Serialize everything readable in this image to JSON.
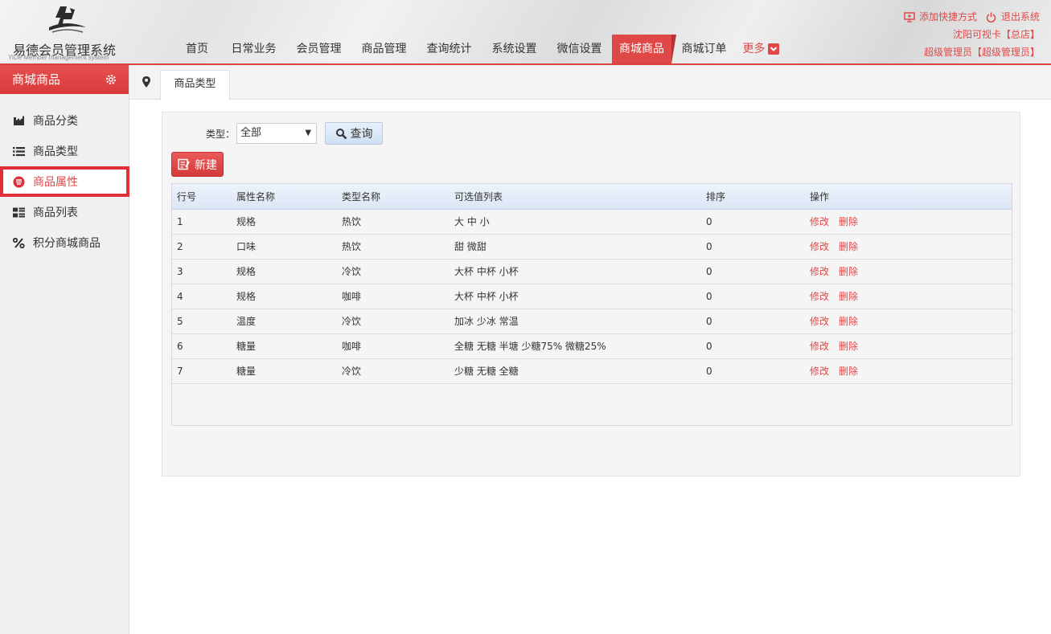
{
  "app": {
    "title": "易德会员管理系统",
    "subtitle": "YiDe Member management system"
  },
  "nav": {
    "items": [
      {
        "label": "首页",
        "name": "nav-home",
        "active": false
      },
      {
        "label": "日常业务",
        "name": "nav-daily",
        "active": false
      },
      {
        "label": "会员管理",
        "name": "nav-member",
        "active": false
      },
      {
        "label": "商品管理",
        "name": "nav-goods",
        "active": false
      },
      {
        "label": "查询统计",
        "name": "nav-query",
        "active": false
      },
      {
        "label": "系统设置",
        "name": "nav-settings",
        "active": false
      },
      {
        "label": "微信设置",
        "name": "nav-wechat",
        "active": false
      },
      {
        "label": "商城商品",
        "name": "nav-mall-goods",
        "active": true
      },
      {
        "label": "商城订单",
        "name": "nav-mall-orders",
        "active": false
      }
    ],
    "more_label": "更多"
  },
  "top_right": {
    "add_shortcut": "添加快捷方式",
    "logout": "退出系统",
    "store": "沈阳可视卡【总店】",
    "user": "超级管理员【超级管理员】"
  },
  "sidebar": {
    "title": "商城商品",
    "items": [
      {
        "label": "商品分类",
        "icon": "factory-icon"
      },
      {
        "label": "商品类型",
        "icon": "list-icon"
      },
      {
        "label": "商品属性",
        "icon": "tag-circle-icon"
      },
      {
        "label": "商品列表",
        "icon": "grid-list-icon"
      },
      {
        "label": "积分商城商品",
        "icon": "percent-icon"
      }
    ],
    "active_index": 2
  },
  "tabs": {
    "current": "商品类型"
  },
  "filter": {
    "type_label": "类型：",
    "type_value": "全部",
    "query_label": "查询"
  },
  "toolbar": {
    "new_label": "新建"
  },
  "table": {
    "headers": [
      "行号",
      "属性名称",
      "类型名称",
      "可选值列表",
      "排序",
      "操作"
    ],
    "edit_label": "修改",
    "delete_label": "删除",
    "rows": [
      {
        "no": "1",
        "attr": "规格",
        "type": "热饮",
        "values": "大 中 小",
        "sort": "0"
      },
      {
        "no": "2",
        "attr": "口味",
        "type": "热饮",
        "values": "甜 微甜",
        "sort": "0"
      },
      {
        "no": "3",
        "attr": "规格",
        "type": "冷饮",
        "values": "大杯 中杯 小杯",
        "sort": "0"
      },
      {
        "no": "4",
        "attr": "规格",
        "type": "咖啡",
        "values": "大杯 中杯 小杯",
        "sort": "0"
      },
      {
        "no": "5",
        "attr": "温度",
        "type": "冷饮",
        "values": "加冰 少冰 常温",
        "sort": "0"
      },
      {
        "no": "6",
        "attr": "糖量",
        "type": "咖啡",
        "values": "全糖 无糖 半塘 少糖75% 微糖25%",
        "sort": "0"
      },
      {
        "no": "7",
        "attr": "糖量",
        "type": "冷饮",
        "values": "少糖 无糖 全糖",
        "sort": "0"
      }
    ]
  },
  "colors": {
    "accent": "#e04848",
    "active_border": "#e0303a"
  }
}
